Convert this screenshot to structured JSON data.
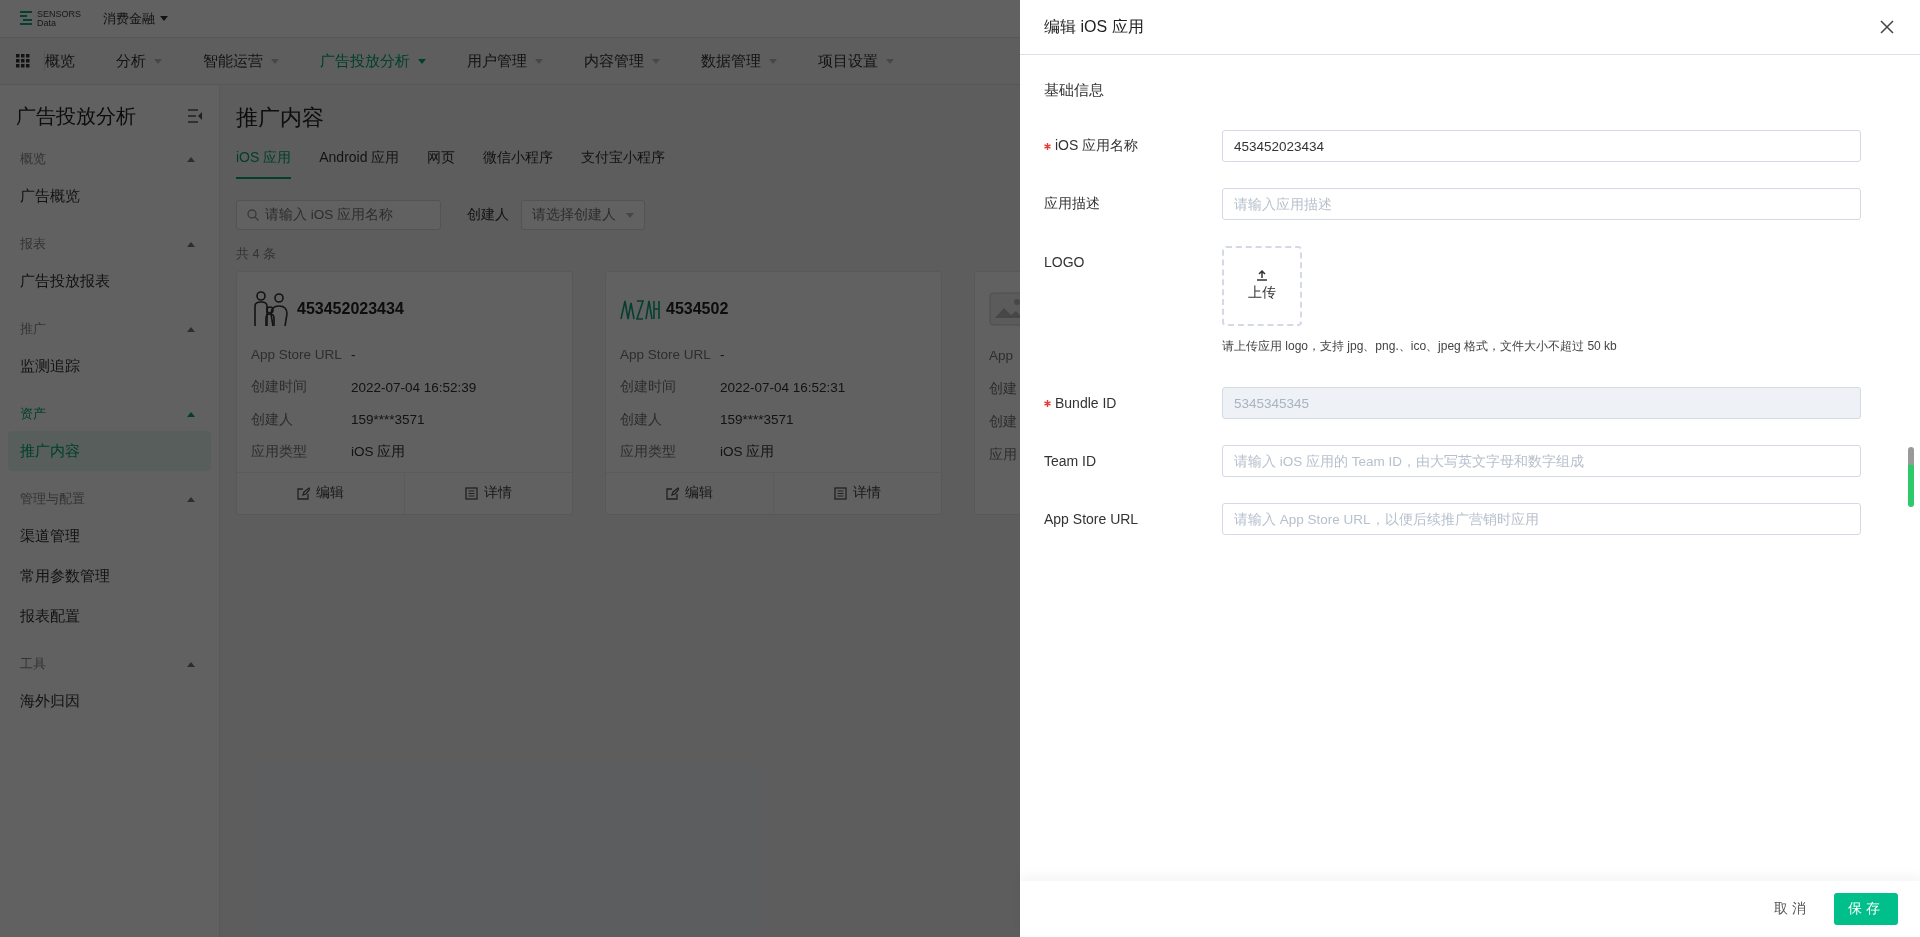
{
  "topbar": {
    "logo_top": "SENSORS",
    "logo_bottom": "Data",
    "project": "消费金融"
  },
  "nav": [
    {
      "label": "概览",
      "selected": false,
      "has_menu": false
    },
    {
      "label": "分析",
      "selected": false,
      "has_menu": true
    },
    {
      "label": "智能运营",
      "selected": false,
      "has_menu": true
    },
    {
      "label": "广告投放分析",
      "selected": true,
      "has_menu": true
    },
    {
      "label": "用户管理",
      "selected": false,
      "has_menu": true
    },
    {
      "label": "内容管理",
      "selected": false,
      "has_menu": true
    },
    {
      "label": "数据管理",
      "selected": false,
      "has_menu": true
    },
    {
      "label": "项目设置",
      "selected": false,
      "has_menu": true
    }
  ],
  "sidebar": {
    "title": "广告投放分析",
    "groups": [
      {
        "label": "概览",
        "selected": false,
        "expanded": true,
        "items": [
          {
            "label": "广告概览",
            "selected": false
          }
        ]
      },
      {
        "label": "报表",
        "selected": false,
        "expanded": true,
        "items": [
          {
            "label": "广告投放报表",
            "selected": false
          }
        ]
      },
      {
        "label": "推广",
        "selected": false,
        "expanded": true,
        "items": [
          {
            "label": "监测追踪",
            "selected": false
          }
        ]
      },
      {
        "label": "资产",
        "selected": true,
        "expanded": true,
        "items": [
          {
            "label": "推广内容",
            "selected": true
          }
        ]
      },
      {
        "label": "管理与配置",
        "selected": false,
        "expanded": true,
        "items": [
          {
            "label": "渠道管理",
            "selected": false
          },
          {
            "label": "常用参数管理",
            "selected": false
          },
          {
            "label": "报表配置",
            "selected": false
          }
        ]
      },
      {
        "label": "工具",
        "selected": false,
        "expanded": true,
        "items": [
          {
            "label": "海外归因",
            "selected": false
          }
        ]
      }
    ]
  },
  "main": {
    "title": "推广内容",
    "tabs": [
      {
        "label": "iOS 应用",
        "selected": true
      },
      {
        "label": "Android 应用",
        "selected": false
      },
      {
        "label": "网页",
        "selected": false
      },
      {
        "label": "微信小程序",
        "selected": false
      },
      {
        "label": "支付宝小程序",
        "selected": false
      }
    ],
    "search": {
      "placeholder": "请输入 iOS 应用名称"
    },
    "creator_filter": {
      "label": "创建人",
      "placeholder": "请选择创建人"
    },
    "total": "共 4 条",
    "cards": [
      {
        "kind": "family",
        "title": "453452023434",
        "rows": [
          {
            "label": "App Store URL",
            "value": "-"
          },
          {
            "label": "创建时间",
            "value": "2022-07-04 16:52:39"
          },
          {
            "label": "创建人",
            "value": "159****3571"
          },
          {
            "label": "应用类型",
            "value": "iOS 应用"
          }
        ],
        "actions": [
          "编辑",
          "详情"
        ]
      },
      {
        "kind": "wave",
        "title": "4534502",
        "rows": [
          {
            "label": "App Store URL",
            "value": "-"
          },
          {
            "label": "创建时间",
            "value": "2022-07-04 16:52:31"
          },
          {
            "label": "创建人",
            "value": "159****3571"
          },
          {
            "label": "应用类型",
            "value": "iOS 应用"
          }
        ],
        "actions": [
          "编辑",
          "详情"
        ]
      },
      {
        "kind": "image",
        "rows": [
          {
            "label": "App"
          },
          {
            "label": "创建"
          },
          {
            "label": "创建"
          },
          {
            "label": "应用"
          }
        ]
      }
    ]
  },
  "drawer": {
    "title": "编辑 iOS 应用",
    "section": "基础信息",
    "fields": [
      {
        "kind": "text",
        "label": "iOS 应用名称",
        "required": true,
        "value": "453452023434",
        "disabled": false
      },
      {
        "kind": "text",
        "label": "应用描述",
        "required": false,
        "placeholder": "请输入应用描述",
        "disabled": false
      },
      {
        "kind": "upload",
        "label": "LOGO",
        "required": false,
        "button": "上传",
        "hint": "请上传应用 logo，支持 jpg、png.、ico、jpeg 格式，文件大小不超过 50 kb"
      },
      {
        "kind": "text",
        "label": "Bundle ID",
        "required": true,
        "value": "5345345345",
        "disabled": true
      },
      {
        "kind": "text",
        "label": "Team ID",
        "required": false,
        "placeholder": "请输入 iOS 应用的 Team ID，由大写英文字母和数字组成",
        "disabled": false
      },
      {
        "kind": "text",
        "label": "App Store URL",
        "required": false,
        "placeholder": "请输入 App Store URL，以便后续推广营销时应用",
        "disabled": false
      }
    ],
    "buttons": [
      {
        "label": "取消",
        "kind": "secondary"
      },
      {
        "label": "保存",
        "kind": "primary"
      }
    ]
  }
}
